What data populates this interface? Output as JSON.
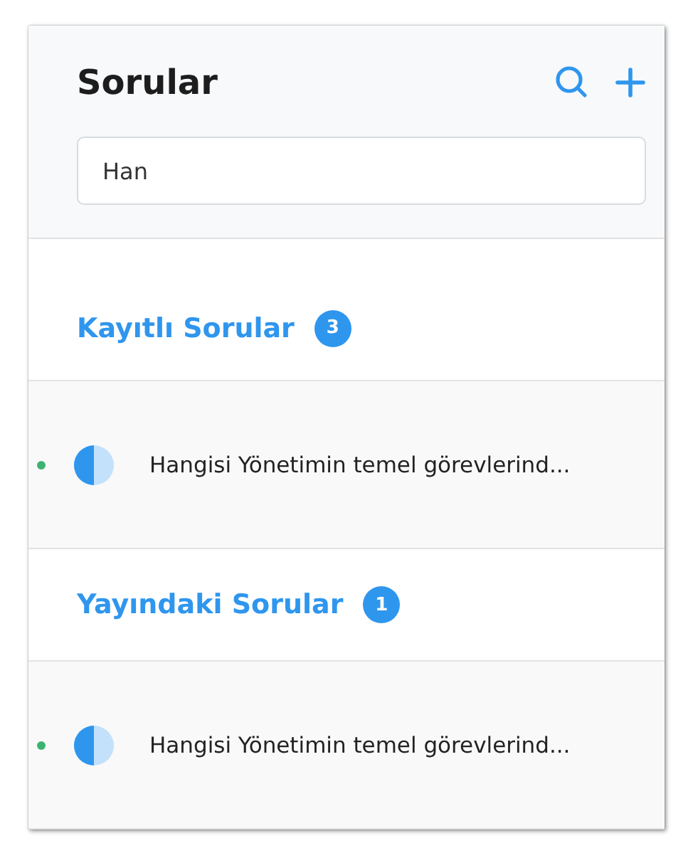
{
  "header": {
    "title": "Sorular",
    "search": {
      "value": "Han"
    }
  },
  "sections": [
    {
      "title": "Kayıtlı Sorular",
      "count": "3",
      "items": [
        {
          "text": "Hangisi Yönetimin temel görevlerind...",
          "color": "#3cb371"
        }
      ]
    },
    {
      "title": "Yayındaki Sorular",
      "count": "1",
      "items": [
        {
          "text": "Hangisi Yönetimin temel görevlerind...",
          "color": "#3cb371"
        }
      ]
    }
  ]
}
